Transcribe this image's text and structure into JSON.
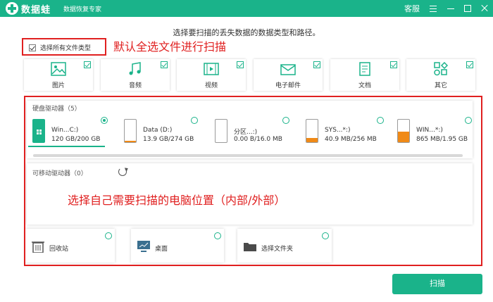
{
  "titlebar": {
    "app_name": "数据蛙",
    "subtitle": "数据恢复专家",
    "service_label": "客服"
  },
  "header": {
    "instruction": "选择要扫描的丢失数据的数据类型和路径。",
    "select_all_label": "选择所有文件类型",
    "annotation_select_all": "默认全选文件进行扫描"
  },
  "file_types": [
    {
      "label": "图片",
      "icon": "image-icon",
      "checked": true
    },
    {
      "label": "音频",
      "icon": "music-icon",
      "checked": true
    },
    {
      "label": "视频",
      "icon": "video-icon",
      "checked": true
    },
    {
      "label": "电子邮件",
      "icon": "email-icon",
      "checked": true
    },
    {
      "label": "文档",
      "icon": "document-icon",
      "checked": true
    },
    {
      "label": "其它",
      "icon": "other-icon",
      "checked": true
    }
  ],
  "drives_section": {
    "title": "硬盘驱动器（5）",
    "drives": [
      {
        "name": "Win...C:)",
        "size": "120 GB/200 GB",
        "used_fraction": 0.6,
        "selected": true,
        "os_drive": true
      },
      {
        "name": "Data (D:)",
        "size": "13.9 GB/274 GB",
        "used_fraction": 0.05,
        "selected": false
      },
      {
        "name": "分区...:)",
        "size": "0.00  B/16.0 MB",
        "used_fraction": 0.0,
        "selected": false
      },
      {
        "name": "SYS...*:)",
        "size": "40.9 MB/256 MB",
        "used_fraction": 0.16,
        "selected": false
      },
      {
        "name": "WIN...*:)",
        "size": "865 MB/1.95 GB",
        "used_fraction": 0.43,
        "selected": false
      }
    ]
  },
  "removable_section": {
    "title": "可移动驱动器（0）"
  },
  "annotation_location": "选择自己需要扫描的电脑位置（内部/外部）",
  "locations": [
    {
      "label": "回收站",
      "icon": "recycle-bin-icon"
    },
    {
      "label": "桌面",
      "icon": "desktop-icon"
    },
    {
      "label": "选择文件夹",
      "icon": "folder-icon"
    }
  ],
  "scan_label": "扫描",
  "colors": {
    "accent": "#1ab38a",
    "annotation": "#e02020",
    "drive_fill": "#f08a17"
  }
}
